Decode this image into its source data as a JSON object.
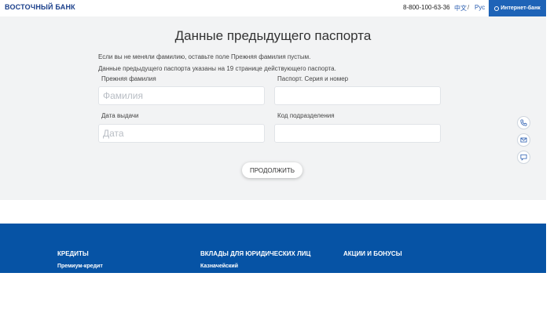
{
  "header": {
    "logo_text": "ВОСТОЧНЫЙ БАНК",
    "phone": "8-800-100-63-36",
    "lang_zh": "中文",
    "lang_sep": "/",
    "lang_ru": "Рус",
    "internet_bank_label": "Интернет-банк"
  },
  "form": {
    "title": "Данные предыдущего паспорта",
    "note_line1": "Если вы не меняли фамилию, оставьте поле Прежняя фамилия пустым.",
    "note_line2": "Данные предыдущего паспорта указаны на 19 странице действующего паспорта.",
    "fields": [
      {
        "label": "Прежняя фамилия",
        "placeholder": "Фамилия",
        "value": ""
      },
      {
        "label": "Паспорт. Серия и номер",
        "placeholder": "",
        "value": ""
      },
      {
        "label": "Дата выдачи",
        "placeholder": "Дата",
        "value": ""
      },
      {
        "label": "Код подразделения",
        "placeholder": "",
        "value": ""
      }
    ],
    "continue_label": "ПРОДОЛЖИТЬ"
  },
  "side_buttons": [
    "phone-icon",
    "mail-icon",
    "chat-icon"
  ],
  "footer": {
    "columns": [
      {
        "title": "КРЕДИТЫ",
        "item": "Премиум-кредит"
      },
      {
        "title": "ВКЛАДЫ ДЛЯ ЮРИДИЧЕСКИХ ЛИЦ",
        "item": "Казначейский"
      },
      {
        "title": "АКЦИИ И БОНУСЫ",
        "item": ""
      }
    ]
  },
  "colors": {
    "brand_blue": "#1e63b7",
    "footer_blue": "#0653a5",
    "logo_blue": "#1a3f8b",
    "logo_accent": "#e85a1a",
    "form_bg": "#f2f3f4"
  }
}
